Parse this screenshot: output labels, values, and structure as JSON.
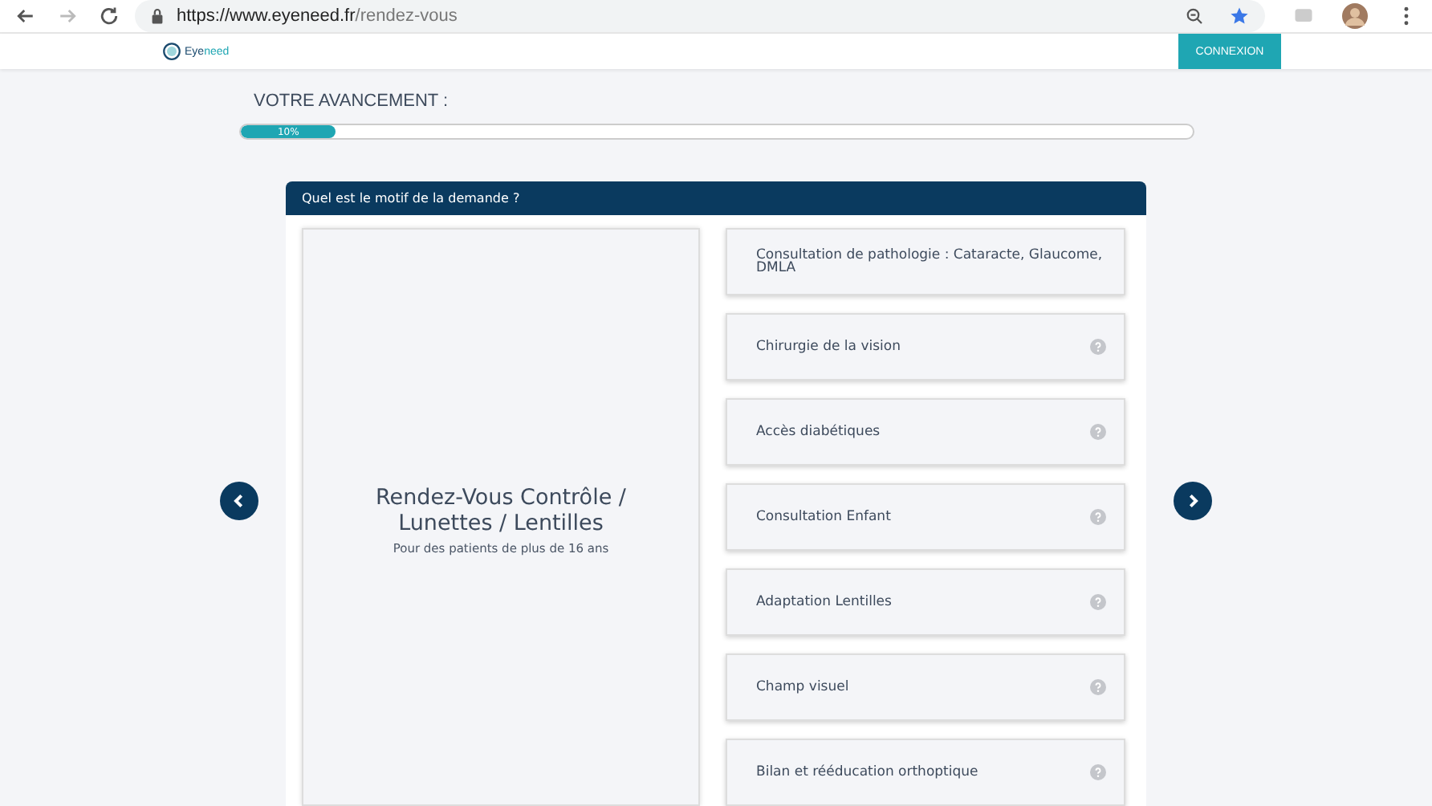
{
  "browser": {
    "url_host": "https://www.eyeneed.fr",
    "url_path": "/rendez-vous"
  },
  "header": {
    "logo_part1": "Eye",
    "logo_part2": "need",
    "login_button": "CONNEXION"
  },
  "progress": {
    "title": "VOTRE AVANCEMENT :",
    "level": 0.1,
    "reading": "10%"
  },
  "question": {
    "title": "Quel est le motif de la demande ?"
  },
  "featured": {
    "title": "Rendez-Vous Contrôle / Lunettes / Lentilles",
    "subtitle": "Pour des patients de plus de 16 ans"
  },
  "options": [
    {
      "label": "Consultation de pathologie : Cataracte, Glaucome, DMLA",
      "help": false
    },
    {
      "label": "Chirurgie de la vision",
      "help": true
    },
    {
      "label": "Accès diabétiques",
      "help": true
    },
    {
      "label": "Consultation Enfant",
      "help": true
    },
    {
      "label": "Adaptation Lentilles",
      "help": true
    },
    {
      "label": "Champ visuel",
      "help": true
    },
    {
      "label": "Bilan et rééducation orthoptique",
      "help": true
    }
  ]
}
